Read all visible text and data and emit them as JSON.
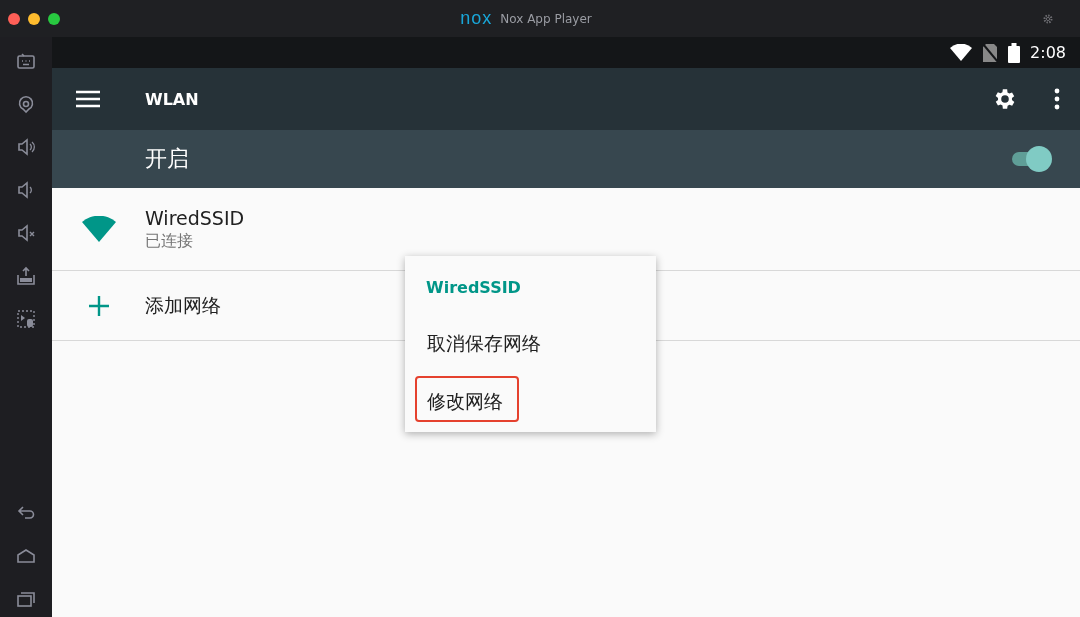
{
  "window": {
    "logo": "nox",
    "title": "Nox App Player"
  },
  "status_bar": {
    "time": "2:08"
  },
  "toolbar": {
    "title": "WLAN"
  },
  "switch_bar": {
    "label": "开启",
    "on": true
  },
  "networks": [
    {
      "kind": "wifi",
      "name": "WiredSSID",
      "status": "已连接"
    },
    {
      "kind": "add",
      "name": "添加网络"
    }
  ],
  "context_menu": {
    "title": "WiredSSID",
    "items": [
      {
        "label": "取消保存网络",
        "highlighted": false
      },
      {
        "label": "修改网络",
        "highlighted": true
      }
    ]
  }
}
